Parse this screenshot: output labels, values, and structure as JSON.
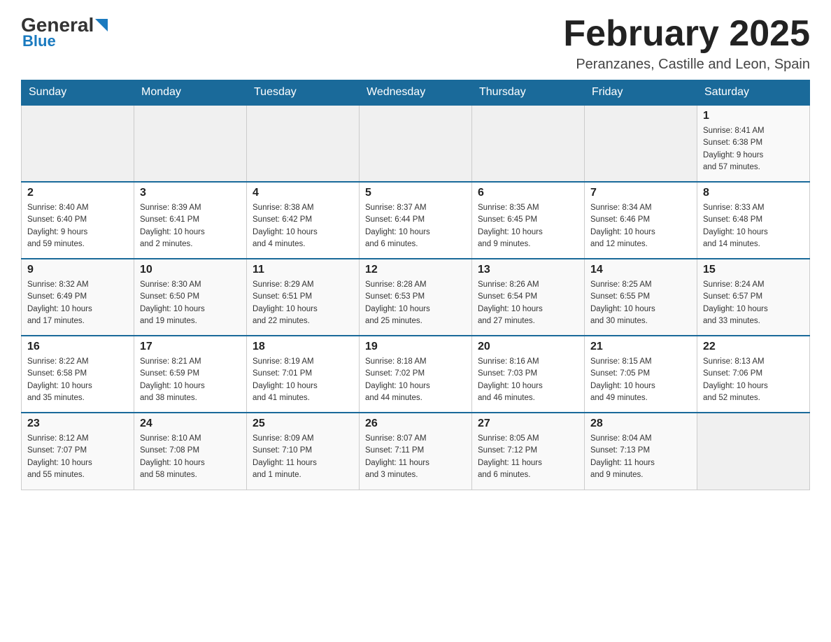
{
  "logo": {
    "general": "General",
    "blue": "Blue"
  },
  "header": {
    "month_title": "February 2025",
    "location": "Peranzanes, Castille and Leon, Spain"
  },
  "days_of_week": [
    "Sunday",
    "Monday",
    "Tuesday",
    "Wednesday",
    "Thursday",
    "Friday",
    "Saturday"
  ],
  "weeks": [
    [
      {
        "day": "",
        "info": ""
      },
      {
        "day": "",
        "info": ""
      },
      {
        "day": "",
        "info": ""
      },
      {
        "day": "",
        "info": ""
      },
      {
        "day": "",
        "info": ""
      },
      {
        "day": "",
        "info": ""
      },
      {
        "day": "1",
        "info": "Sunrise: 8:41 AM\nSunset: 6:38 PM\nDaylight: 9 hours\nand 57 minutes."
      }
    ],
    [
      {
        "day": "2",
        "info": "Sunrise: 8:40 AM\nSunset: 6:40 PM\nDaylight: 9 hours\nand 59 minutes."
      },
      {
        "day": "3",
        "info": "Sunrise: 8:39 AM\nSunset: 6:41 PM\nDaylight: 10 hours\nand 2 minutes."
      },
      {
        "day": "4",
        "info": "Sunrise: 8:38 AM\nSunset: 6:42 PM\nDaylight: 10 hours\nand 4 minutes."
      },
      {
        "day": "5",
        "info": "Sunrise: 8:37 AM\nSunset: 6:44 PM\nDaylight: 10 hours\nand 6 minutes."
      },
      {
        "day": "6",
        "info": "Sunrise: 8:35 AM\nSunset: 6:45 PM\nDaylight: 10 hours\nand 9 minutes."
      },
      {
        "day": "7",
        "info": "Sunrise: 8:34 AM\nSunset: 6:46 PM\nDaylight: 10 hours\nand 12 minutes."
      },
      {
        "day": "8",
        "info": "Sunrise: 8:33 AM\nSunset: 6:48 PM\nDaylight: 10 hours\nand 14 minutes."
      }
    ],
    [
      {
        "day": "9",
        "info": "Sunrise: 8:32 AM\nSunset: 6:49 PM\nDaylight: 10 hours\nand 17 minutes."
      },
      {
        "day": "10",
        "info": "Sunrise: 8:30 AM\nSunset: 6:50 PM\nDaylight: 10 hours\nand 19 minutes."
      },
      {
        "day": "11",
        "info": "Sunrise: 8:29 AM\nSunset: 6:51 PM\nDaylight: 10 hours\nand 22 minutes."
      },
      {
        "day": "12",
        "info": "Sunrise: 8:28 AM\nSunset: 6:53 PM\nDaylight: 10 hours\nand 25 minutes."
      },
      {
        "day": "13",
        "info": "Sunrise: 8:26 AM\nSunset: 6:54 PM\nDaylight: 10 hours\nand 27 minutes."
      },
      {
        "day": "14",
        "info": "Sunrise: 8:25 AM\nSunset: 6:55 PM\nDaylight: 10 hours\nand 30 minutes."
      },
      {
        "day": "15",
        "info": "Sunrise: 8:24 AM\nSunset: 6:57 PM\nDaylight: 10 hours\nand 33 minutes."
      }
    ],
    [
      {
        "day": "16",
        "info": "Sunrise: 8:22 AM\nSunset: 6:58 PM\nDaylight: 10 hours\nand 35 minutes."
      },
      {
        "day": "17",
        "info": "Sunrise: 8:21 AM\nSunset: 6:59 PM\nDaylight: 10 hours\nand 38 minutes."
      },
      {
        "day": "18",
        "info": "Sunrise: 8:19 AM\nSunset: 7:01 PM\nDaylight: 10 hours\nand 41 minutes."
      },
      {
        "day": "19",
        "info": "Sunrise: 8:18 AM\nSunset: 7:02 PM\nDaylight: 10 hours\nand 44 minutes."
      },
      {
        "day": "20",
        "info": "Sunrise: 8:16 AM\nSunset: 7:03 PM\nDaylight: 10 hours\nand 46 minutes."
      },
      {
        "day": "21",
        "info": "Sunrise: 8:15 AM\nSunset: 7:05 PM\nDaylight: 10 hours\nand 49 minutes."
      },
      {
        "day": "22",
        "info": "Sunrise: 8:13 AM\nSunset: 7:06 PM\nDaylight: 10 hours\nand 52 minutes."
      }
    ],
    [
      {
        "day": "23",
        "info": "Sunrise: 8:12 AM\nSunset: 7:07 PM\nDaylight: 10 hours\nand 55 minutes."
      },
      {
        "day": "24",
        "info": "Sunrise: 8:10 AM\nSunset: 7:08 PM\nDaylight: 10 hours\nand 58 minutes."
      },
      {
        "day": "25",
        "info": "Sunrise: 8:09 AM\nSunset: 7:10 PM\nDaylight: 11 hours\nand 1 minute."
      },
      {
        "day": "26",
        "info": "Sunrise: 8:07 AM\nSunset: 7:11 PM\nDaylight: 11 hours\nand 3 minutes."
      },
      {
        "day": "27",
        "info": "Sunrise: 8:05 AM\nSunset: 7:12 PM\nDaylight: 11 hours\nand 6 minutes."
      },
      {
        "day": "28",
        "info": "Sunrise: 8:04 AM\nSunset: 7:13 PM\nDaylight: 11 hours\nand 9 minutes."
      },
      {
        "day": "",
        "info": ""
      }
    ]
  ]
}
